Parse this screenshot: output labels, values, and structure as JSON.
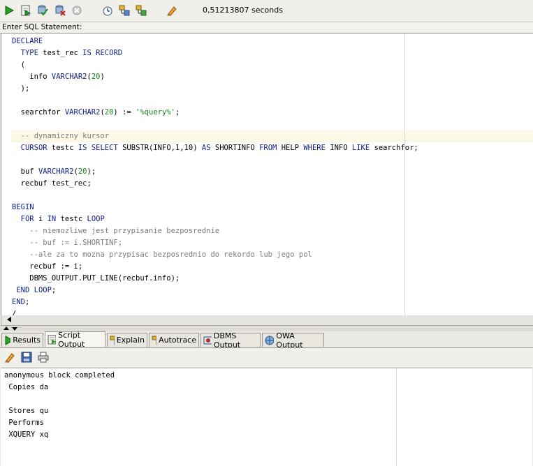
{
  "toolbar": {
    "icons": [
      "run-statement-icon",
      "run-script-icon",
      "commit-icon",
      "rollback-icon",
      "cancel-icon",
      "sql-history-icon",
      "explain-plan-icon",
      "autotrace-icon",
      "clear-icon"
    ],
    "timing": "0,51213807 seconds"
  },
  "editor": {
    "label": "Enter SQL Statement:",
    "lines": [
      [
        {
          "t": "DECLARE",
          "k": "kw"
        }
      ],
      [
        {
          "t": "  "
        },
        {
          "t": "TYPE",
          "k": "kw"
        },
        {
          "t": " test_rec "
        },
        {
          "t": "IS",
          "k": "kw"
        },
        {
          "t": " "
        },
        {
          "t": "RECORD",
          "k": "kw"
        }
      ],
      [
        {
          "t": "  ("
        }
      ],
      [
        {
          "t": "    info "
        },
        {
          "t": "VARCHAR2",
          "k": "kw"
        },
        {
          "t": "("
        },
        {
          "t": "20",
          "k": "num"
        },
        {
          "t": ")"
        }
      ],
      [
        {
          "t": "  );"
        }
      ],
      [
        {
          "t": ""
        }
      ],
      [
        {
          "t": "  searchfor "
        },
        {
          "t": "VARCHAR2",
          "k": "kw"
        },
        {
          "t": "("
        },
        {
          "t": "20",
          "k": "num"
        },
        {
          "t": ") := "
        },
        {
          "t": "'%query%'",
          "k": "str"
        },
        {
          "t": ";"
        }
      ],
      [
        {
          "t": ""
        }
      ],
      [
        {
          "t": "  -- dynamiczny kursor",
          "k": "cm"
        }
      ],
      [
        {
          "t": "  "
        },
        {
          "t": "CURSOR",
          "k": "kw"
        },
        {
          "t": " testc "
        },
        {
          "t": "IS",
          "k": "kw"
        },
        {
          "t": " "
        },
        {
          "t": "SELECT",
          "k": "kw"
        },
        {
          "t": " SUBSTR(INFO,1,10) "
        },
        {
          "t": "AS",
          "k": "kw"
        },
        {
          "t": " SHORTINFO "
        },
        {
          "t": "FROM",
          "k": "kw"
        },
        {
          "t": " HELP "
        },
        {
          "t": "WHERE",
          "k": "kw"
        },
        {
          "t": " INFO "
        },
        {
          "t": "LIKE",
          "k": "kw"
        },
        {
          "t": " searchfor;"
        }
      ],
      [
        {
          "t": ""
        }
      ],
      [
        {
          "t": "  buf "
        },
        {
          "t": "VARCHAR2",
          "k": "kw"
        },
        {
          "t": "("
        },
        {
          "t": "20",
          "k": "num"
        },
        {
          "t": ");"
        }
      ],
      [
        {
          "t": "  recbuf test_rec;"
        }
      ],
      [
        {
          "t": ""
        }
      ],
      [
        {
          "t": "BEGIN",
          "k": "kw"
        }
      ],
      [
        {
          "t": "  "
        },
        {
          "t": "FOR",
          "k": "kw"
        },
        {
          "t": " i "
        },
        {
          "t": "IN",
          "k": "kw"
        },
        {
          "t": " testc "
        },
        {
          "t": "LOOP",
          "k": "kw"
        }
      ],
      [
        {
          "t": "    -- niemozliwe jest przypisanie bezposrednie",
          "k": "cm"
        }
      ],
      [
        {
          "t": "    -- buf := i.SHORTINF;",
          "k": "cm"
        }
      ],
      [
        {
          "t": "    --ale za to mozna przypisac bezposrednio do rekordo lub jego pol",
          "k": "cm"
        }
      ],
      [
        {
          "t": "    recbuf := i;"
        }
      ],
      [
        {
          "t": "    DBMS_OUTPUT.PUT_LINE(recbuf.info);"
        }
      ],
      [
        {
          "t": " "
        },
        {
          "t": "END",
          "k": "kw"
        },
        {
          "t": " "
        },
        {
          "t": "LOOP",
          "k": "kw"
        },
        {
          "t": ";"
        }
      ],
      [
        {
          "t": "END",
          "k": "kw"
        },
        {
          "t": ";"
        }
      ],
      [
        {
          "t": "/"
        }
      ]
    ]
  },
  "tabs": [
    {
      "label": "Results",
      "icon": "run-icon"
    },
    {
      "label": "Script Output",
      "icon": "script-output-icon",
      "active": true
    },
    {
      "label": "Explain",
      "icon": "explain-icon"
    },
    {
      "label": "Autotrace",
      "icon": "autotrace-icon"
    },
    {
      "label": "DBMS Output",
      "icon": "dbms-output-icon"
    },
    {
      "label": "OWA Output",
      "icon": "owa-output-icon"
    }
  ],
  "output_toolbar": [
    "clear-output-icon",
    "save-output-icon",
    "print-output-icon"
  ],
  "output": {
    "lines": [
      "anonymous block completed",
      " Copies da",
      "",
      " Stores qu",
      " Performs",
      " XQUERY xq"
    ]
  },
  "colors": {
    "keyword": "#12208c",
    "number": "#1a7f21",
    "comment": "#7b7b7b",
    "current_line": "#fbf8e6"
  }
}
